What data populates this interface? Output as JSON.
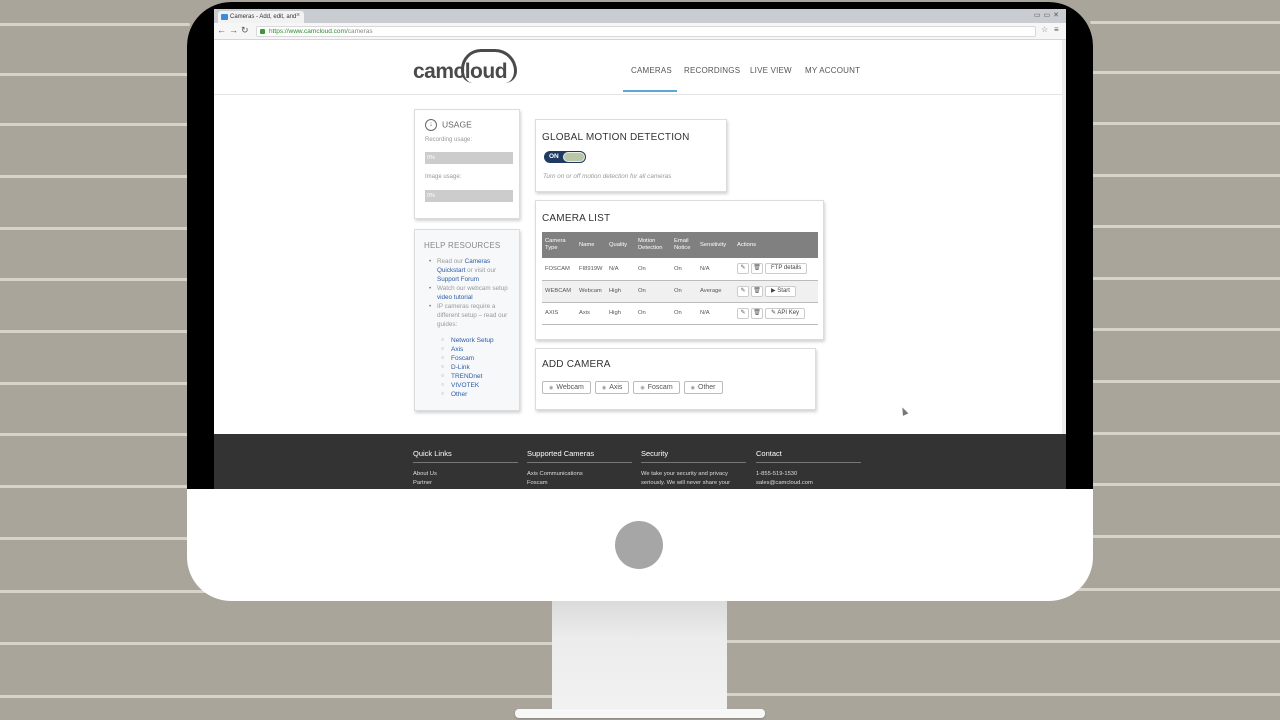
{
  "browser": {
    "tab_title": "Cameras - Add, edit, and",
    "url_host": "https://www.camcloud.com/",
    "url_path": "cameras"
  },
  "site": {
    "logo_text": "camcloud",
    "nav": [
      "CAMERAS",
      "RECORDINGS",
      "LIVE VIEW",
      "MY ACCOUNT"
    ],
    "active_nav": "CAMERAS"
  },
  "usage": {
    "title": "USAGE",
    "recording_label": "Recording usage:",
    "recording_value": "0%",
    "image_label": "Image usage:",
    "image_value": "0%"
  },
  "help": {
    "title": "HELP RESOURCES",
    "items": [
      {
        "pre": "Read our ",
        "link1": "Cameras Quickstart",
        "mid": " or visit our ",
        "link2": "Support Forum"
      },
      {
        "pre": "Watch our webcam setup ",
        "link1": "video tutorial"
      },
      {
        "pre": "IP cameras require a different setup – read our guides:"
      }
    ],
    "guides": [
      "Network Setup",
      "Axis",
      "Foscam",
      "D-Link",
      "TRENDnet",
      "VIVOTEK",
      "Other"
    ]
  },
  "motion": {
    "title": "GLOBAL MOTION DETECTION",
    "toggle_label": "ON",
    "help_text": "Turn on or off motion detection for all cameras"
  },
  "camera_list": {
    "title": "CAMERA LIST",
    "headers": [
      "Camera Type",
      "Name",
      "Quality",
      "Motion Detection",
      "Email Notice",
      "Sensitivity",
      "Actions"
    ],
    "rows": [
      {
        "type": "FOSCAM",
        "name": "FI8919W",
        "quality": "N/A",
        "motion": "On",
        "email": "On",
        "sensitivity": "N/A",
        "action": "FTP details",
        "action_icon": ""
      },
      {
        "type": "WEBCAM",
        "name": "Webcam",
        "quality": "High",
        "motion": "On",
        "email": "On",
        "sensitivity": "Average",
        "action": "Start",
        "action_icon": "▶"
      },
      {
        "type": "AXIS",
        "name": "Axis",
        "quality": "High",
        "motion": "On",
        "email": "On",
        "sensitivity": "N/A",
        "action": "API Key",
        "action_icon": "✎"
      }
    ]
  },
  "add_camera": {
    "title": "ADD CAMERA",
    "buttons": [
      "Webcam",
      "Axis",
      "Foscam",
      "Other"
    ]
  },
  "footer": {
    "columns": [
      {
        "title": "Quick Links",
        "lines": [
          "About Us",
          "Partner"
        ]
      },
      {
        "title": "Supported Cameras",
        "lines": [
          "Axis Communications",
          "Foscam"
        ]
      },
      {
        "title": "Security",
        "lines": [
          "We take your security and privacy",
          "seriously. We will never share your"
        ]
      },
      {
        "title": "Contact",
        "lines": [
          "1-855-519-1530",
          "sales@camcloud.com"
        ]
      }
    ]
  },
  "colors": {
    "wall": "#aaa59b",
    "footer": "#333333",
    "toggle": "#1f3a63",
    "table_header": "#808080",
    "link": "#2b5aa6"
  }
}
